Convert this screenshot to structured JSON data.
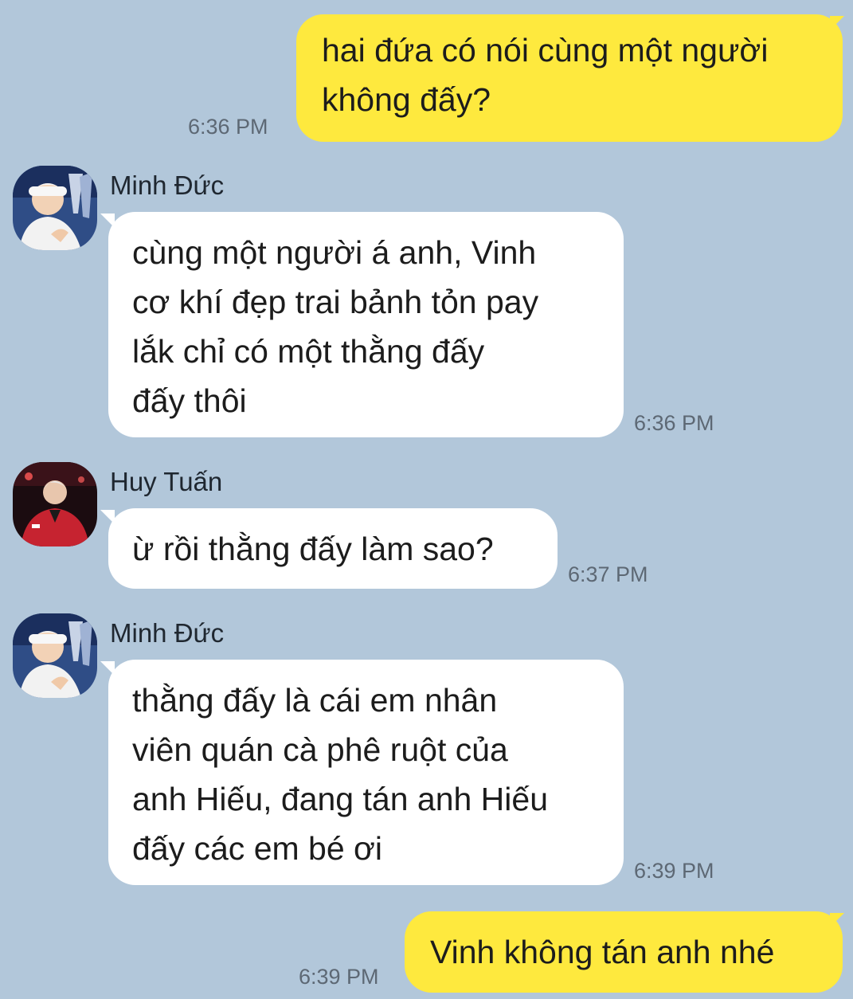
{
  "colors": {
    "background": "#b2c7da",
    "outgoing_bubble": "#fee93e",
    "incoming_bubble": "#ffffff",
    "timestamp": "#5d6874"
  },
  "messages": [
    {
      "sender": "me",
      "text": "hai đứa có nói cùng một người\nkhông đấy?",
      "time": "6:36 PM"
    },
    {
      "sender": "Minh Đức",
      "avatar": "minh-duc-avatar",
      "text": "cùng một người á anh, Vinh\ncơ khí đẹp trai bảnh tỏn pay\nlắk chỉ có một thằng đấy\nđấy thôi",
      "time": "6:36 PM"
    },
    {
      "sender": "Huy Tuấn",
      "avatar": "huy-tuan-avatar",
      "text": "ừ rồi thằng đấy làm sao?",
      "time": "6:37 PM"
    },
    {
      "sender": "Minh Đức",
      "avatar": "minh-duc-avatar",
      "text": "thằng đấy là cái em nhân\nviên quán cà phê ruột của\nanh Hiếu, đang tán anh Hiếu\nđấy các em bé ơi",
      "time": "6:39 PM"
    },
    {
      "sender": "me",
      "text": "Vinh không tán anh nhé",
      "time": "6:39 PM"
    }
  ]
}
